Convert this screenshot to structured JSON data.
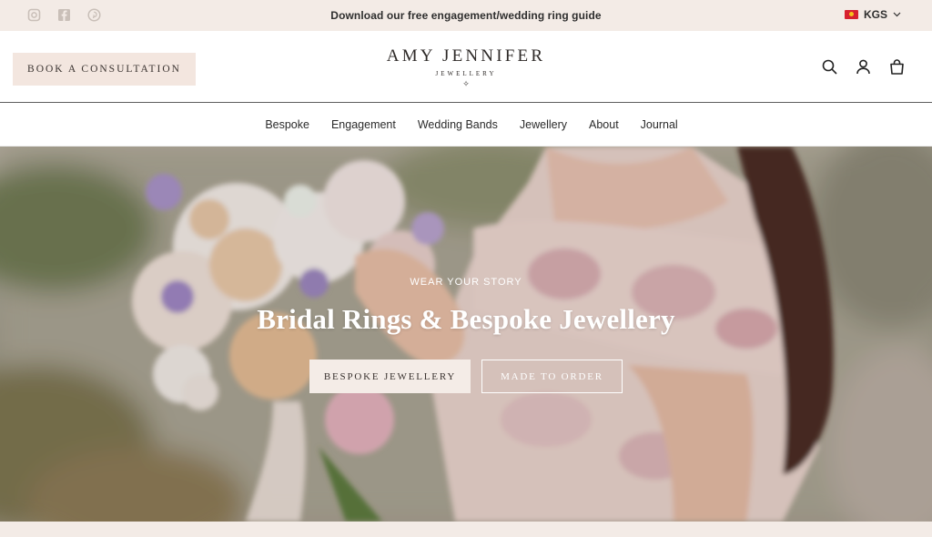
{
  "topbar": {
    "announcement": "Download our free engagement/wedding ring guide",
    "currency": "KGS",
    "social_icons": [
      "instagram-icon",
      "facebook-icon",
      "pinterest-icon"
    ],
    "background": "#f3ebe6"
  },
  "header": {
    "consult_label": "BOOK A CONSULTATION",
    "logo_name": "AMY JENNIFER",
    "logo_sub": "JEWELLERY",
    "logo_mark": "✧",
    "icons": [
      "search-icon",
      "account-icon",
      "cart-icon"
    ],
    "consult_bg": "#f3e6df"
  },
  "nav": {
    "items": [
      {
        "label": "Bespoke"
      },
      {
        "label": "Engagement"
      },
      {
        "label": "Wedding Bands"
      },
      {
        "label": "Jewellery"
      },
      {
        "label": "About"
      },
      {
        "label": "Journal"
      }
    ]
  },
  "hero": {
    "eyebrow": "WEAR YOUR STORY",
    "title": "Bridal Rings & Bespoke Jewellery",
    "primary_button": "BESPOKE JEWELLERY",
    "secondary_button": "MADE TO ORDER"
  }
}
